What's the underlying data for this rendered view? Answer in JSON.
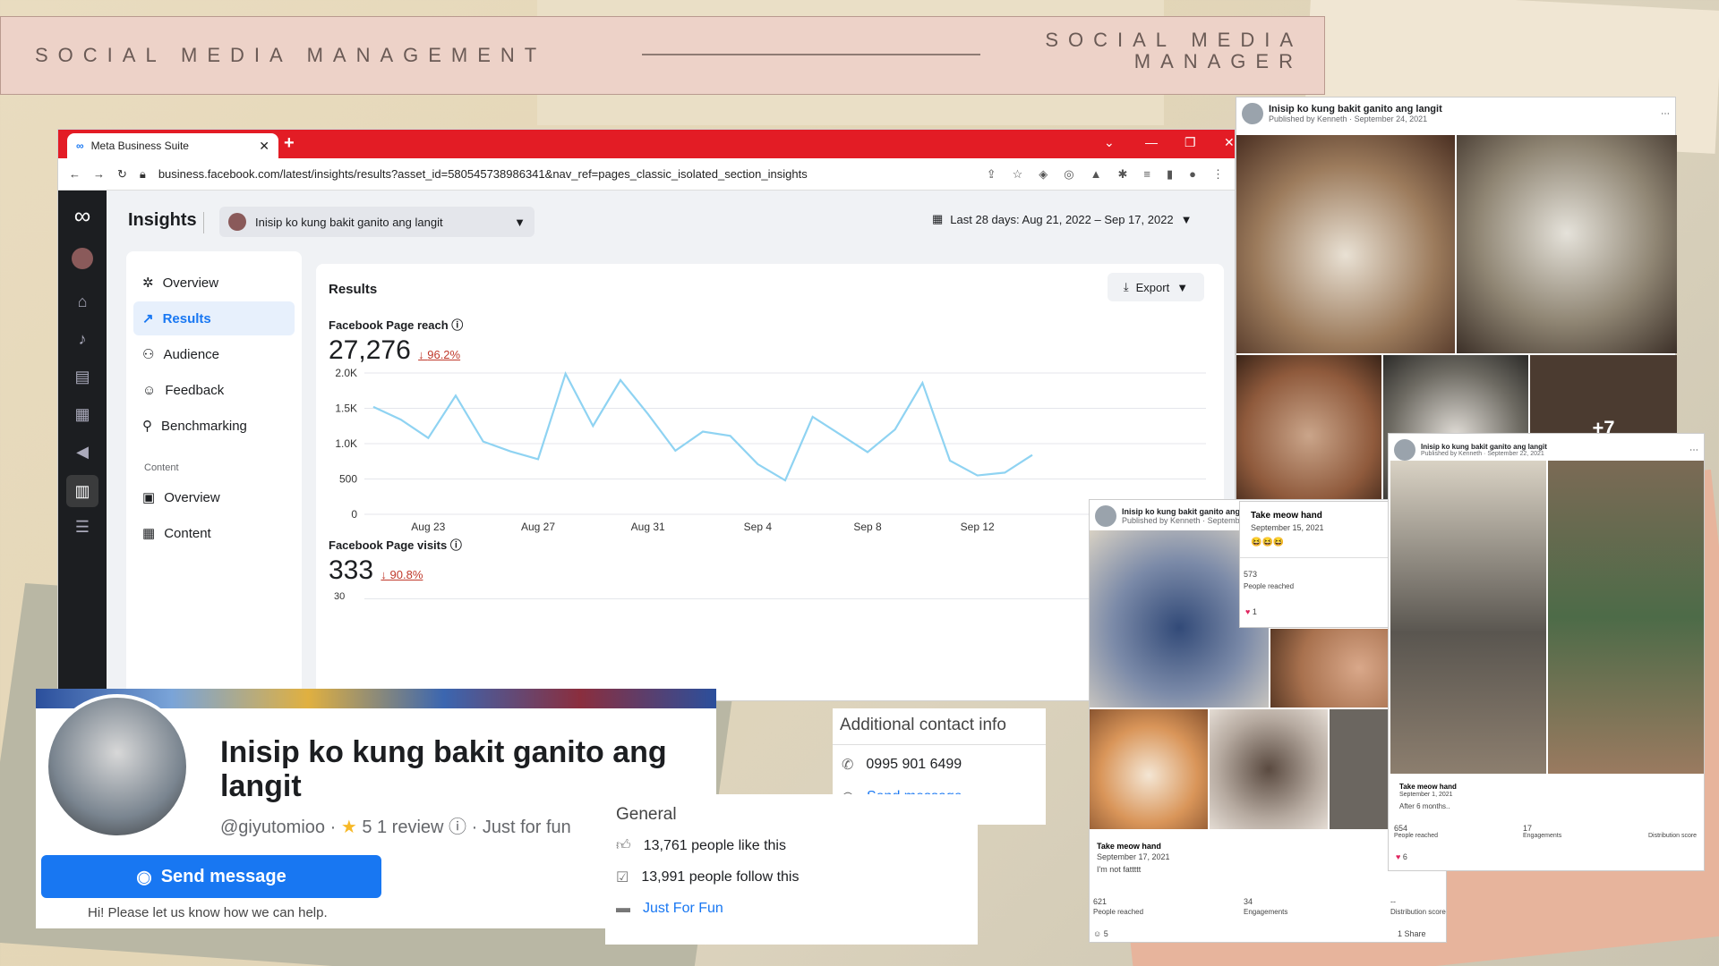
{
  "banner": {
    "left": "SOCIAL MEDIA MANAGEMENT",
    "right_line1": "SOCIAL MEDIA",
    "right_line2": "MANAGER"
  },
  "browser": {
    "tab_title": "Meta Business Suite",
    "url": "business.facebook.com/latest/insights/results?asset_id=580545738986341&nav_ref=pages_classic_isolated_section_insights"
  },
  "insights": {
    "title": "Insights",
    "page_name": "Inisip ko kung bakit ganito ang langit",
    "date_range": "Last 28 days: Aug 21, 2022 – Sep 17, 2022"
  },
  "menu": {
    "items": [
      "Overview",
      "Results",
      "Audience",
      "Feedback",
      "Benchmarking"
    ],
    "content_section": "Content",
    "content_items": [
      "Overview",
      "Content"
    ]
  },
  "results": {
    "title": "Results",
    "export_label": "Export",
    "reach_label": "Facebook Page reach",
    "reach_value": "27,276",
    "reach_change": "96.2%",
    "visits_label": "Facebook Page visits",
    "visits_value": "333",
    "visits_change": "90.8%",
    "visits_first_tick": "30"
  },
  "chart_data": {
    "type": "line",
    "title": "Facebook Page reach",
    "x_tick_labels": [
      "Aug 23",
      "Aug 27",
      "Aug 31",
      "Sep 4",
      "Sep 8",
      "Sep 12"
    ],
    "y_tick_labels": [
      "2.0K",
      "1.5K",
      "1.0K",
      "500",
      "0"
    ],
    "ylim": [
      0,
      2000
    ],
    "x": [
      "Aug 21",
      "Aug 22",
      "Aug 23",
      "Aug 24",
      "Aug 25",
      "Aug 26",
      "Aug 27",
      "Aug 28",
      "Aug 29",
      "Aug 30",
      "Aug 31",
      "Sep 1",
      "Sep 2",
      "Sep 3",
      "Sep 4",
      "Sep 5",
      "Sep 6",
      "Sep 7",
      "Sep 8",
      "Sep 9",
      "Sep 10",
      "Sep 11",
      "Sep 12",
      "Sep 13",
      "Sep 14"
    ],
    "series": [
      {
        "values": [
          1520,
          1340,
          1080,
          1680,
          1030,
          890,
          780,
          1990,
          1250,
          1900,
          1420,
          900,
          1170,
          1110,
          710,
          480,
          1380,
          1130,
          880,
          1200,
          1860,
          760,
          550,
          590,
          840
        ]
      }
    ],
    "color": "#8fd3f2",
    "grid": true
  },
  "profile": {
    "name": "Inisip ko kung bakit ganito ang langit",
    "handle": "@giyutomioo",
    "rating": "5",
    "reviews": "1 review",
    "category": "Just for fun",
    "send_button": "Send message",
    "hint": "Hi! Please let us know how we can help."
  },
  "contact": {
    "title": "Additional contact info",
    "phone": "0995 901 6499",
    "message": "Send message"
  },
  "general": {
    "title": "General",
    "likes": "13,761 people like this",
    "follows": "13,991 people follow this",
    "category_link": "Just For Fun"
  },
  "posts": {
    "p1": {
      "title": "Inisip ko kung bakit ganito ang langit",
      "sub": "Published by Kenneth · September 24, 2021",
      "more": "+7"
    },
    "p2": {
      "title": "Inisip ko kung bakit ganito ang langit",
      "sub": "Published by Kenneth · September 22, 2021",
      "caption": "Take meow hand",
      "date": "September 1, 2021",
      "text": "After 6 months..",
      "reached": "654",
      "reached_label": "People reached",
      "eng": "17",
      "eng_label": "Engagements",
      "dist_label": "Distribution score",
      "reacts": "6"
    },
    "p3": {
      "title": "Inisip ko kung bakit ganito ang langit",
      "sub": "Published by Kenneth · Septembe",
      "caption": "Take meow hand",
      "date": "September 17, 2021",
      "text": "I'm not fattttt",
      "reached": "621",
      "reached_label": "People reached",
      "eng": "34",
      "eng_label": "Engagements",
      "dist": "--",
      "dist_label": "Distribution score",
      "reacts": "5",
      "shares": "1 Share"
    },
    "p4": {
      "caption": "Take meow hand",
      "date": "September 15, 2021",
      "reached": "573",
      "reached_label": "People reached",
      "reacts": "1"
    }
  }
}
